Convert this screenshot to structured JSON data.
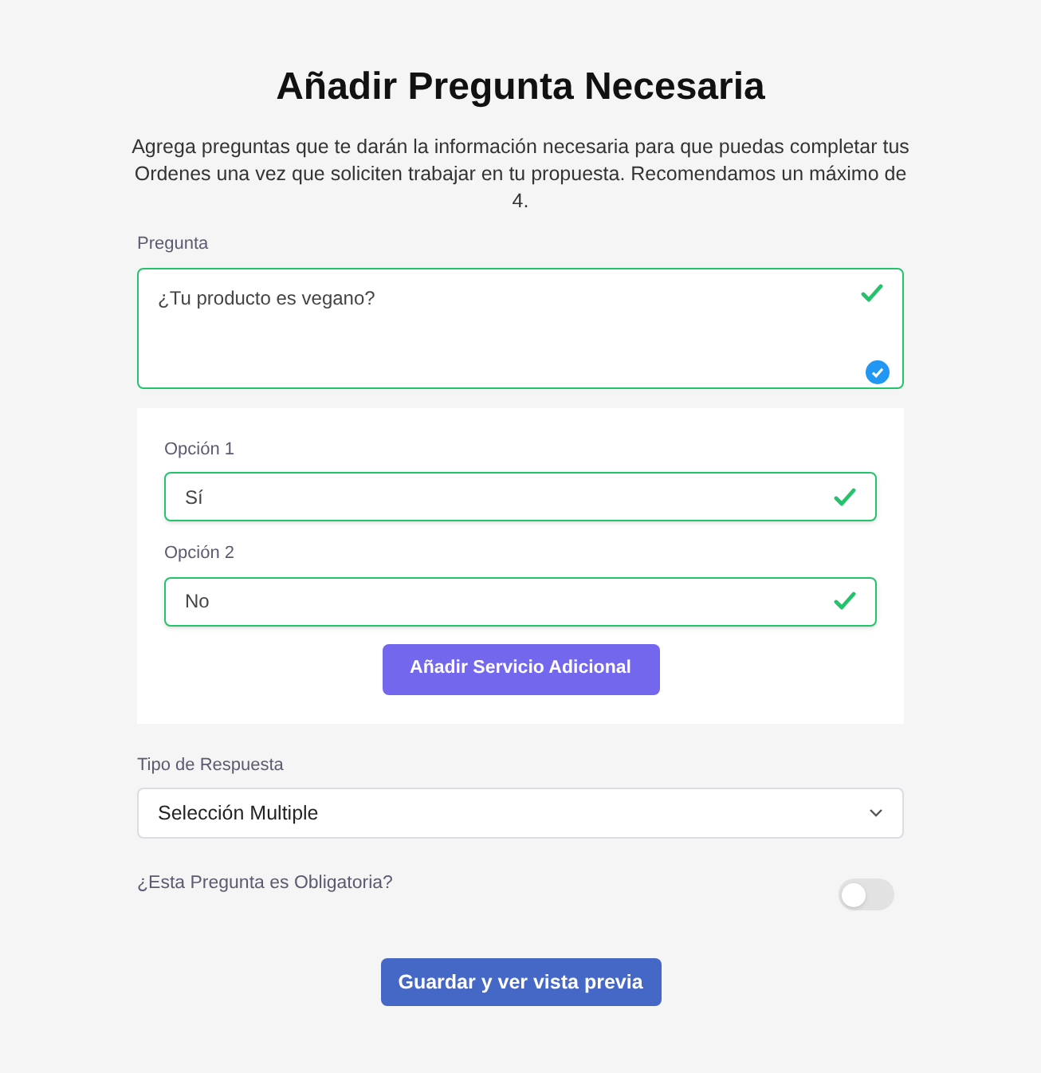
{
  "title": "Añadir Pregunta Necesaria",
  "description": "Agrega preguntas que te darán la información necesaria para que puedas completar tus Ordenes una vez que soliciten trabajar en tu propuesta. Recomendamos un máximo de 4.",
  "question": {
    "label": "Pregunta",
    "value": "¿Tu producto es vegano?",
    "valid": true
  },
  "options": [
    {
      "label": "Opción 1",
      "value": "Sí",
      "valid": true
    },
    {
      "label": "Opción 2",
      "value": "No",
      "valid": true
    }
  ],
  "add_button": "Añadir Servicio Adicional",
  "answer_type": {
    "label": "Tipo de Respuesta",
    "value": "Selección Multiple"
  },
  "required": {
    "label": "¿Esta Pregunta es Obligatoria?",
    "on": false
  },
  "save_button": "Guardar y ver vista previa"
}
